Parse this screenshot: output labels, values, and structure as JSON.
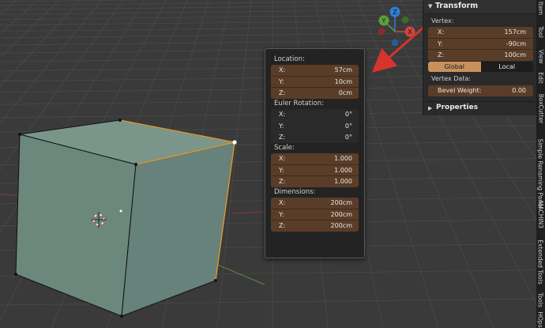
{
  "popup": {
    "location": {
      "label": "Location:",
      "rows": [
        {
          "k": "X:",
          "v": "57cm"
        },
        {
          "k": "Y:",
          "v": "10cm"
        },
        {
          "k": "Z:",
          "v": "0cm"
        }
      ]
    },
    "rotation": {
      "label": "Euler Rotation:",
      "rows": [
        {
          "k": "X:",
          "v": "0°"
        },
        {
          "k": "Y:",
          "v": "0°"
        },
        {
          "k": "Z:",
          "v": "0°"
        }
      ]
    },
    "scale": {
      "label": "Scale:",
      "rows": [
        {
          "k": "X:",
          "v": "1.000"
        },
        {
          "k": "Y:",
          "v": "1.000"
        },
        {
          "k": "Z:",
          "v": "1.000"
        }
      ]
    },
    "dimensions": {
      "label": "Dimensions:",
      "rows": [
        {
          "k": "X:",
          "v": "200cm"
        },
        {
          "k": "Y:",
          "v": "200cm"
        },
        {
          "k": "Z:",
          "v": "200cm"
        }
      ]
    }
  },
  "npanel": {
    "title": "Transform",
    "vertex_label": "Vertex:",
    "vertex": [
      {
        "k": "X:",
        "v": "157cm"
      },
      {
        "k": "Y:",
        "v": "-90cm"
      },
      {
        "k": "Z:",
        "v": "100cm"
      }
    ],
    "space": {
      "global": "Global",
      "local": "Local"
    },
    "vertex_data_label": "Vertex Data:",
    "bevel": {
      "k": "Bevel Weight:",
      "v": "0.00"
    },
    "properties": "Properties"
  },
  "gizmo": {
    "x": "X",
    "y": "Y",
    "z": "Z"
  },
  "tabs": [
    "Item",
    "Tool",
    "View",
    "Edit",
    "BoxCutter",
    "Simple Renaming Panel",
    "MACHIN3",
    "Extended Tools",
    "Tools",
    "HOps"
  ],
  "colors": {
    "field": "#5a3d28",
    "accent": "#c8915c",
    "selected_edge": "#e89a2c",
    "cube_face": "#6f8a7e",
    "annotation_arrow": "#d6342c"
  }
}
